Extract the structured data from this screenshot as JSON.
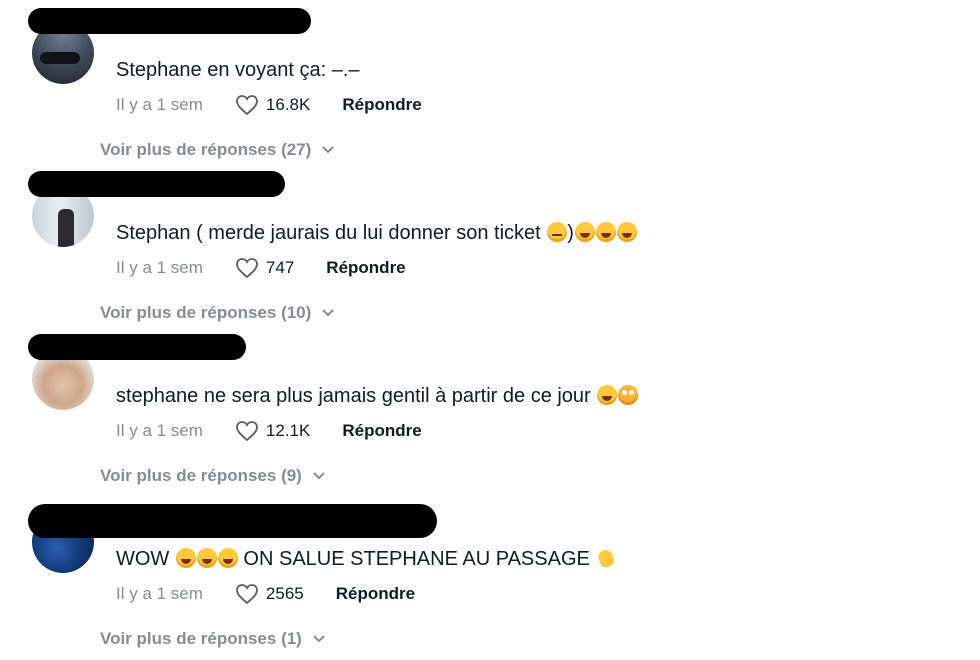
{
  "comments": [
    {
      "text": "Stephane en voyant ça: –.–",
      "emojis": [],
      "time": "Il y a 1 sem",
      "likes": "16.8K",
      "reply_label": "Répondre",
      "more_replies": "Voir plus de réponses (27)"
    },
    {
      "text": "Stephan ( merde jaurais du lui donner son ticket ",
      "text_after": ")",
      "emojis_mid": [
        "neutral-face"
      ],
      "emojis": [
        "face-with-tears-of-joy",
        "face-with-tears-of-joy",
        "face-with-tears-of-joy"
      ],
      "time": "Il y a 1 sem",
      "likes": "747",
      "reply_label": "Répondre",
      "more_replies": "Voir plus de réponses (10)"
    },
    {
      "text": "stephane ne sera plus jamais gentil à partir de ce jour ",
      "emojis": [
        "face-with-tears-of-joy",
        "flushed-face"
      ],
      "time": "Il y a 1 sem",
      "likes": "12.1K",
      "reply_label": "Répondre",
      "more_replies": "Voir plus de réponses (9)"
    },
    {
      "text": "WOW ",
      "text_after": " ON SALUE STEPHANE AU PASSAGE ",
      "emojis_mid": [
        "face-with-tears-of-joy",
        "face-with-tears-of-joy",
        "face-with-tears-of-joy"
      ],
      "emojis": [
        "waving-hand"
      ],
      "time": "Il y a 1 sem",
      "likes": "2565",
      "reply_label": "Répondre",
      "more_replies": "Voir plus de réponses (1)"
    }
  ],
  "icons": {
    "like": "heart-outline-icon",
    "expand": "chevron-down-icon"
  }
}
